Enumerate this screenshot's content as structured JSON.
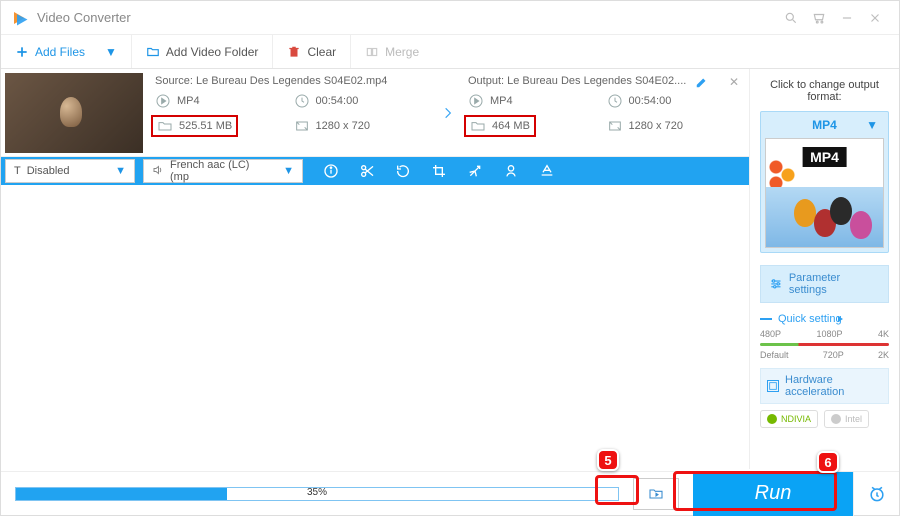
{
  "app": {
    "title": "Video Converter"
  },
  "toolbar": {
    "add_files": "Add Files",
    "add_folder": "Add Video Folder",
    "clear": "Clear",
    "merge": "Merge"
  },
  "item": {
    "source": {
      "heading": "Source: Le Bureau Des Legendes S04E02.mp4",
      "format": "MP4",
      "duration": "00:54:00",
      "size": "525.51 MB",
      "resolution": "1280 x 720"
    },
    "output": {
      "heading": "Output: Le Bureau Des Legendes S04E02....",
      "format": "MP4",
      "duration": "00:54:00",
      "size": "464 MB",
      "resolution": "1280 x 720"
    }
  },
  "toolstrip": {
    "subtitle": "Disabled",
    "audio": "French aac (LC) (mp"
  },
  "side": {
    "heading": "Click to change output format:",
    "format": "MP4",
    "format_badge": "MP4",
    "param": "Parameter settings",
    "quick": "Quick setting",
    "presets_top": [
      "480P",
      "1080P",
      "4K"
    ],
    "presets_bottom": [
      "Default",
      "720P",
      "2K"
    ],
    "hw": "Hardware acceleration",
    "gpu1": "NDIVIA",
    "gpu2": "Intel"
  },
  "footer": {
    "progress_pct": 35,
    "progress_label": "35%",
    "run": "Run"
  },
  "callouts": {
    "c5": "5",
    "c6": "6"
  }
}
